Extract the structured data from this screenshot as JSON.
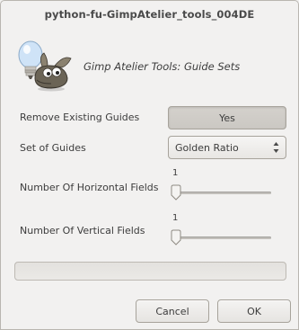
{
  "window": {
    "title": "python-fu-GimpAtelier_tools_004DE"
  },
  "header": {
    "subtitle": "Gimp Atelier Tools: Guide Sets",
    "logo_icon": "gimp-wilber-lightbulb-icon"
  },
  "form": {
    "remove_guides": {
      "label": "Remove Existing Guides",
      "button_label": "Yes"
    },
    "guide_set": {
      "label": "Set of Guides",
      "selected": "Golden Ratio"
    },
    "horizontal_fields": {
      "label": "Number Of Horizontal Fields",
      "value": "1",
      "min_fraction": 0
    },
    "vertical_fields": {
      "label": "Number Of Vertical Fields",
      "value": "1",
      "min_fraction": 0
    }
  },
  "progress": {
    "fraction": 0
  },
  "actions": {
    "cancel_label": "Cancel",
    "ok_label": "OK"
  }
}
